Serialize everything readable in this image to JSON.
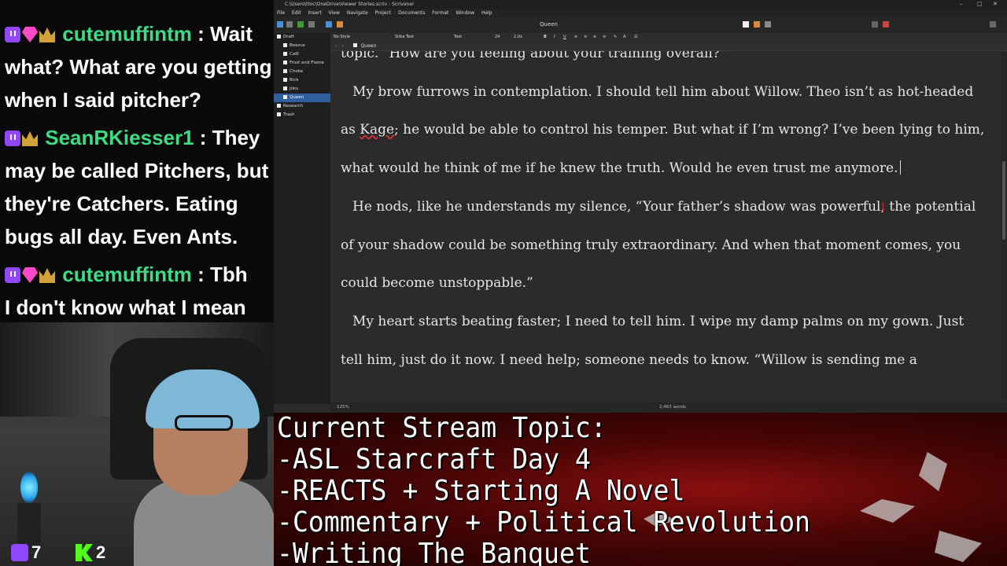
{
  "chat": {
    "messages": [
      {
        "user": "cutemuffintm",
        "lines": [
          " : Wait",
          "what? What are you getting",
          "when I said pitcher?"
        ],
        "badges": [
          "twitch",
          "gem",
          "crown"
        ]
      },
      {
        "user": "SeanRKiesser1",
        "lines": [
          " : They",
          "may be called Pitchers, but",
          "they're Catchers. Eating",
          "bugs all day. Even Ants."
        ],
        "badges": [
          "twitch",
          "crown"
        ]
      },
      {
        "user": "cutemuffintm",
        "lines": [
          " : Tbh",
          "I don't know what I mean"
        ],
        "badges": [
          "twitch",
          "gem",
          "crown"
        ]
      }
    ],
    "username_color": "#3ddc84"
  },
  "stats": {
    "twitch_viewers": "7",
    "kick_viewers": "2"
  },
  "scrivener": {
    "window_title": "C:\\Users\\ttoc\\OneDrive\\Viewer Stories.scriv - Scrivener",
    "menu": [
      "File",
      "Edit",
      "Insert",
      "View",
      "Navigate",
      "Project",
      "Documents",
      "Format",
      "Window",
      "Help"
    ],
    "toolbar_doc_title": "Queen",
    "format": {
      "style": "No Style",
      "font": "Sitka Text",
      "face": "Text",
      "size": "24",
      "spacing": "2.0x"
    },
    "binder": [
      {
        "label": "Draft",
        "level": 0
      },
      {
        "label": "Beezus",
        "level": 1
      },
      {
        "label": "Calli",
        "level": 1
      },
      {
        "label": "Frost and Flame",
        "level": 1
      },
      {
        "label": "Choke",
        "level": 1
      },
      {
        "label": "Rick",
        "level": 1
      },
      {
        "label": "Joku",
        "level": 1
      },
      {
        "label": "Queen",
        "level": 1,
        "selected": true
      },
      {
        "label": "Research",
        "level": 0
      },
      {
        "label": "Trash",
        "level": 0
      }
    ],
    "editor_header": "Queen",
    "paragraphs": [
      {
        "text": "topic. \"How are you feeling about your training overall?\"",
        "flush": true
      },
      {
        "text_before": "My brow furrows in contemplation. I should tell him about Willow. Theo isn’t as hot-headed as ",
        "misspelled": "Kage",
        "text_after": "; he would be able to control his temper. But what if I’m wrong? I’ve been lying to him, what would he think of me if he knew the truth. Would he even trust me anymore.",
        "flush": false
      },
      {
        "text": "He nods, like he understands my silence, “Your father’s shadow was powerful, the potential of your shadow could be something truly extraordinary. And when that moment comes, you could become unstoppable.”",
        "flush": false
      },
      {
        "text": "My heart starts beating faster; I need to tell him. I wipe my damp palms on my gown. Just tell him, just do it now. I need help; someone needs to know. “Willow is sending me a",
        "flush": false
      }
    ],
    "zoom": "125%",
    "word_count": "2,463 words"
  },
  "topic": {
    "lines": [
      "Current Stream Topic:",
      "-ASL Starcraft Day 4",
      "-REACTS + Starting A Novel",
      "-Commentary + Political Revolution",
      "-Writing The Banquet"
    ]
  }
}
